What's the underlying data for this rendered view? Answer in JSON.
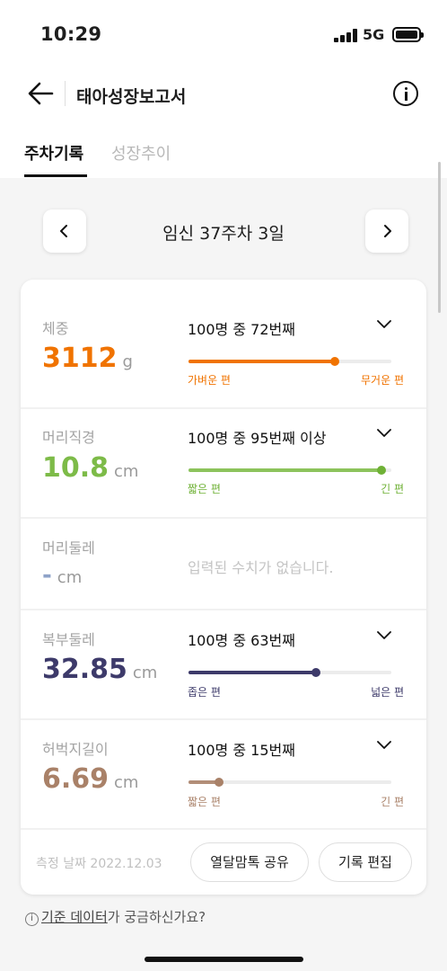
{
  "status": {
    "time": "10:29",
    "network": "5G"
  },
  "header": {
    "title": "태아성장보고서"
  },
  "tabs": [
    {
      "label": "주차기록"
    },
    {
      "label": "성장추이"
    }
  ],
  "week": {
    "label": "임신 37주차 3일"
  },
  "measurements": [
    {
      "label": "체중",
      "value": "3112",
      "unit": "g",
      "rank": "100명 중 72번째",
      "percentile": 0.72,
      "low_label": "가벼운 편",
      "high_label": "무거운 편",
      "color": "#f07300",
      "fill_color": "#f07300",
      "value_color": "#f07300"
    },
    {
      "label": "머리직경",
      "value": "10.8",
      "unit": "cm",
      "rank": "100명 중 95번째 이상",
      "percentile": 0.95,
      "low_label": "짧은 편",
      "high_label": "긴 편",
      "color": "#6fb136",
      "fill_color": "#8cc35c",
      "value_color": "#7dbb48"
    },
    {
      "label": "머리둘레",
      "value": "-",
      "unit": "cm",
      "empty_text": "입력된 수치가 없습니다."
    },
    {
      "label": "복부둘레",
      "value": "32.85",
      "unit": "cm",
      "rank": "100명 중 63번째",
      "percentile": 0.63,
      "low_label": "좁은 편",
      "high_label": "넓은 편",
      "color": "#3d3a6a",
      "fill_color": "#3d3a6a",
      "value_color": "#3d3a6a"
    },
    {
      "label": "허벅지길이",
      "value": "6.69",
      "unit": "cm",
      "rank": "100명 중 15번째",
      "percentile": 0.15,
      "low_label": "짧은 편",
      "high_label": "긴 편",
      "color": "#a98168",
      "fill_color": "#b28e78",
      "value_color": "#a98168"
    }
  ],
  "footer": {
    "date": "측정 날짜 2022.12.03",
    "share_label": "열달맘톡 공유",
    "edit_label": "기록 편집",
    "help_link": "기준 데이터",
    "help_rest": "가 궁금하신가요?",
    "help_icon": "i"
  }
}
